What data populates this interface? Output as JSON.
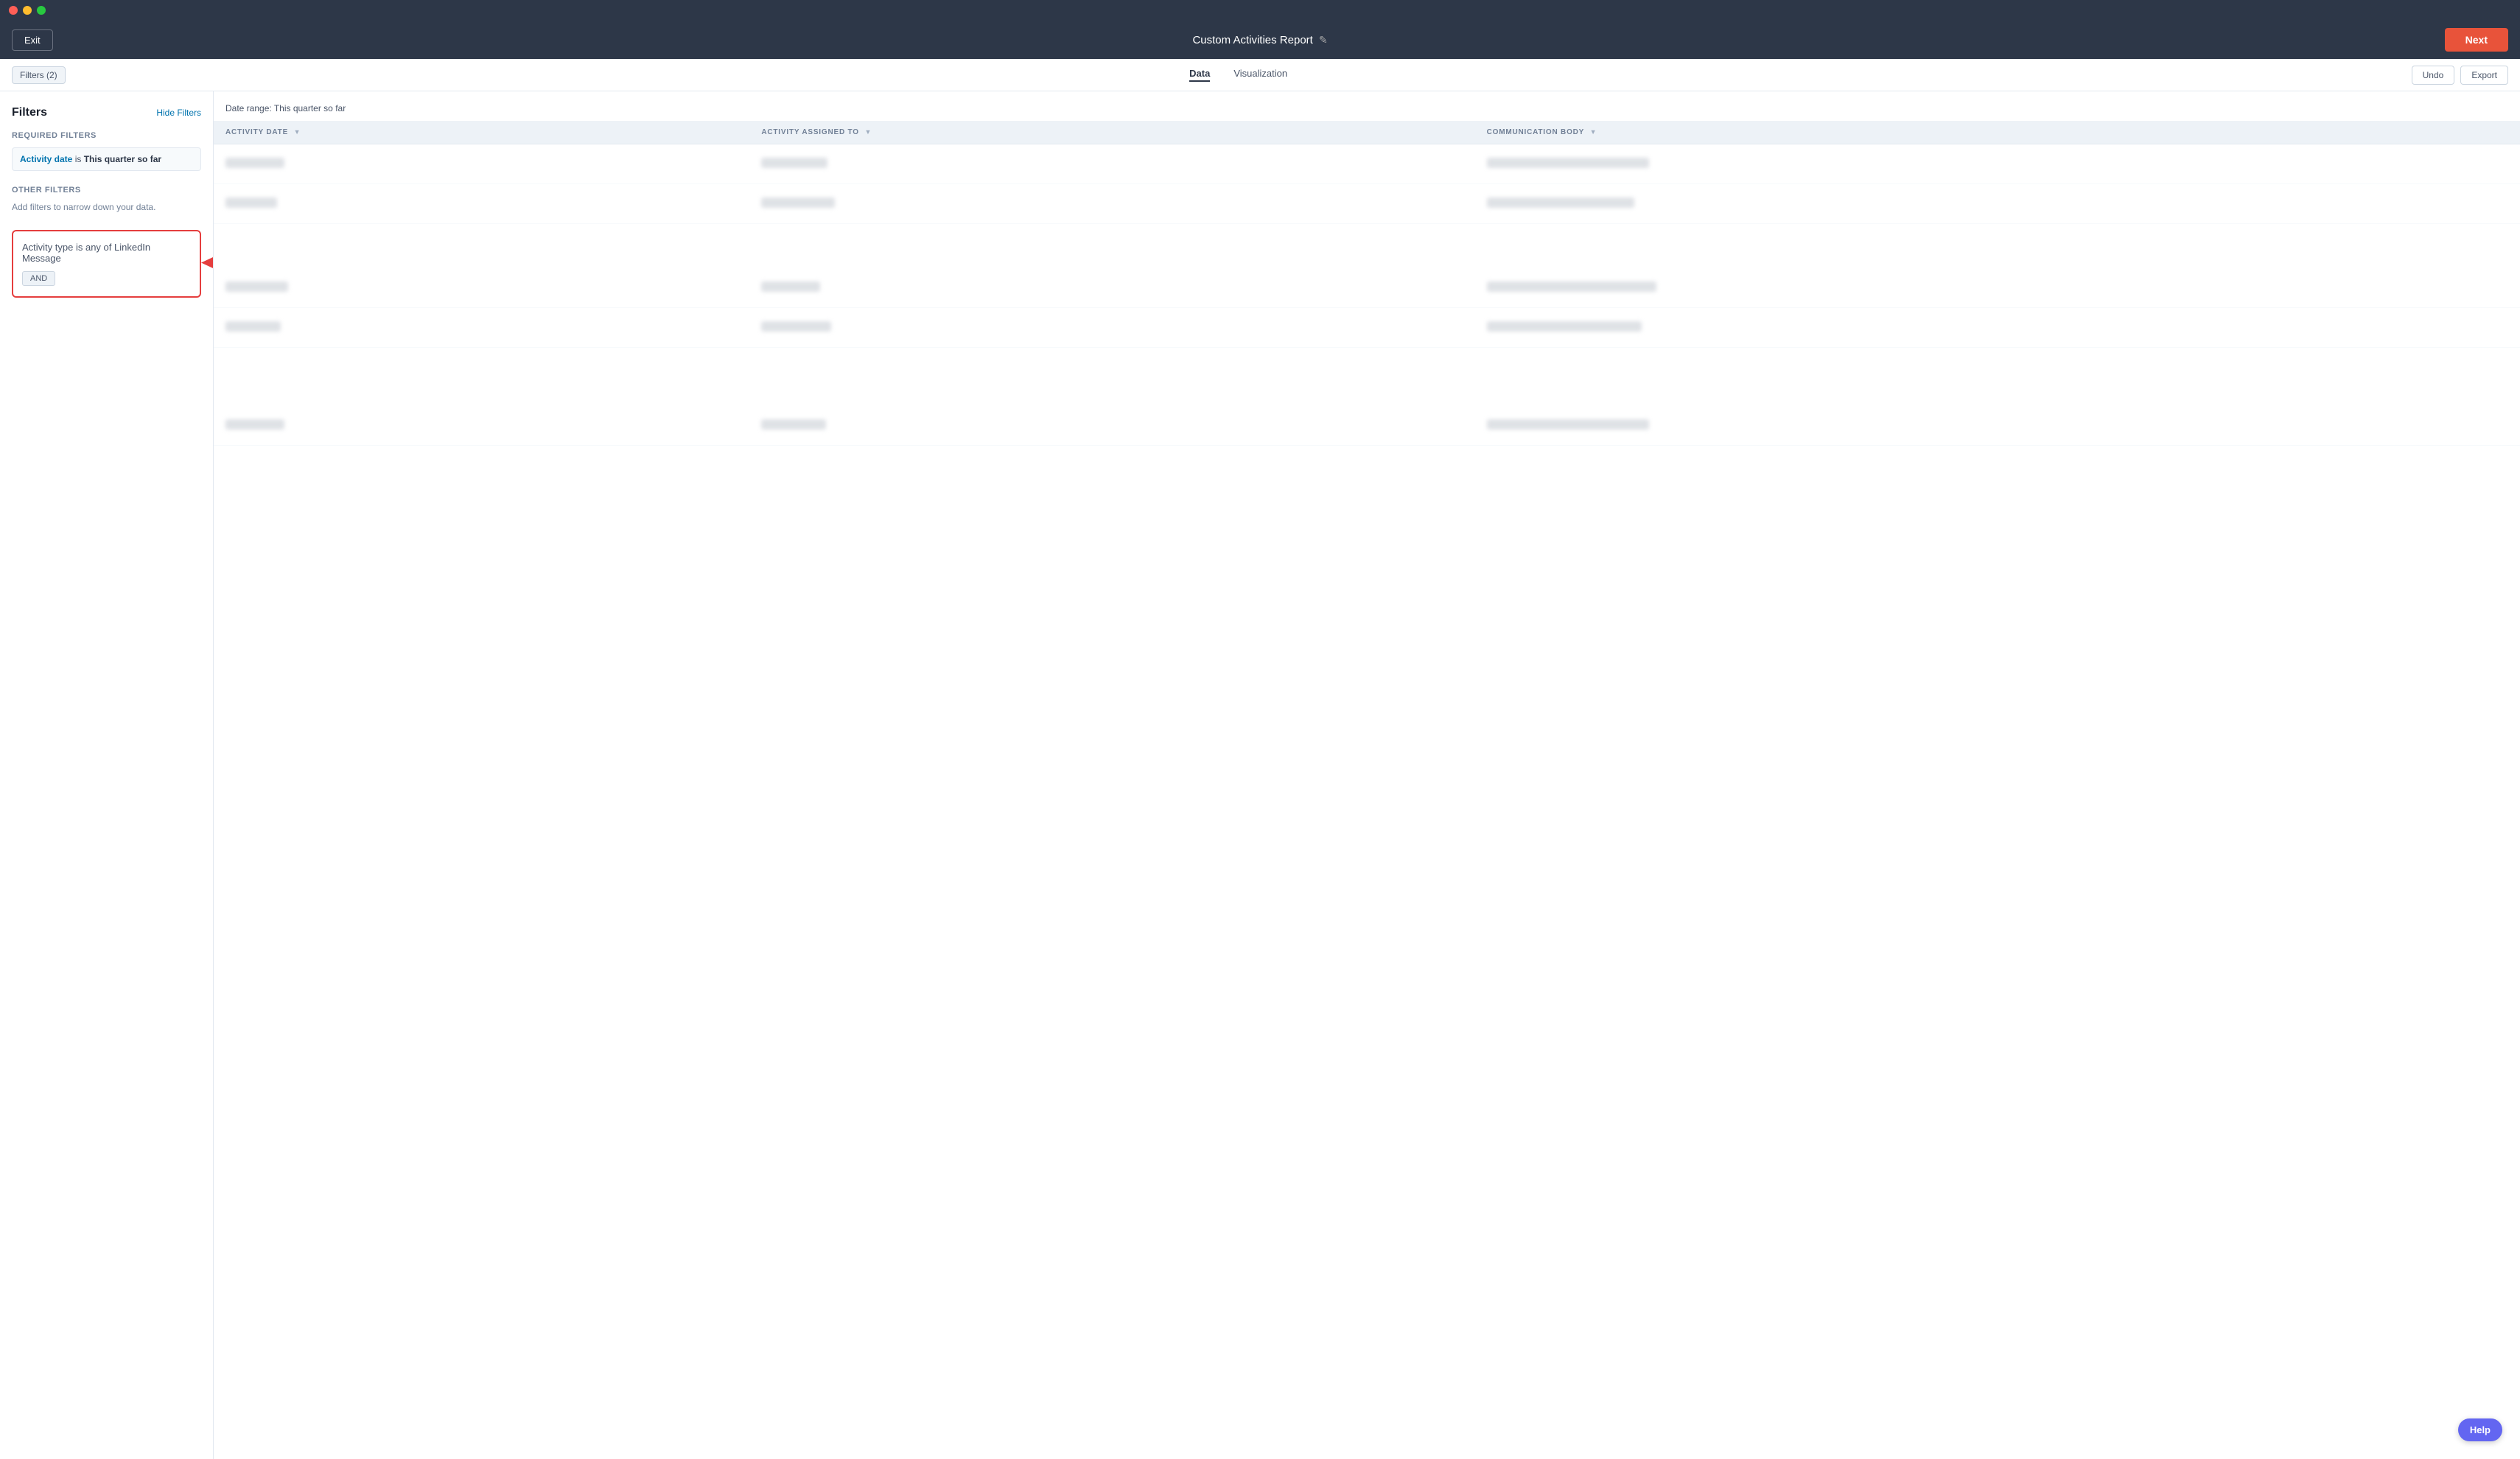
{
  "titlebar": {
    "dots": [
      "red",
      "yellow",
      "green"
    ]
  },
  "topnav": {
    "exit_label": "Exit",
    "title": "Custom Activities Report",
    "edit_icon": "✎",
    "next_label": "Next"
  },
  "tabbar": {
    "filters_badge": "Filters (2)",
    "tabs": [
      {
        "id": "data",
        "label": "Data",
        "active": true
      },
      {
        "id": "visualization",
        "label": "Visualization",
        "active": false
      }
    ],
    "undo_label": "Undo",
    "export_label": "Export"
  },
  "filters_panel": {
    "title": "Filters",
    "hide_filters_label": "Hide Filters",
    "required_section": "Required filters",
    "required_filter": {
      "link_text": "Activity date",
      "static_text": " is ",
      "bold_text": "This quarter so far"
    },
    "other_section": "Other filters",
    "other_desc": "Add filters to narrow down your data.",
    "highlighted_filter": {
      "link_text": "Activity type",
      "static_text": " is any of ",
      "bold_text": "LinkedIn Message"
    },
    "and_label": "AND"
  },
  "content": {
    "date_range_label": "Date range: This quarter so far",
    "columns": [
      {
        "id": "activity_date",
        "label": "ACTIVITY DATE",
        "sortable": true
      },
      {
        "id": "activity_assigned_to",
        "label": "ACTIVITY ASSIGNED TO",
        "sortable": true
      },
      {
        "id": "communication_body",
        "label": "COMMUNICATION BODY",
        "sortable": true
      }
    ],
    "blur_rows": [
      {
        "col1_w": 80,
        "col1_h": 14,
        "col2_w": 90,
        "col2_h": 14,
        "col3_w": 160,
        "col3_h": 14
      },
      {
        "col1_w": 70,
        "col1_h": 14,
        "col2_w": 100,
        "col2_h": 14,
        "col3_w": 140,
        "col3_h": 14
      },
      {
        "col1_w": 85,
        "col1_h": 14,
        "col2_w": 80,
        "col2_h": 14,
        "col3_w": 170,
        "col3_h": 14
      },
      {
        "col1_w": 75,
        "col1_h": 14,
        "col2_w": 95,
        "col2_h": 14,
        "col3_w": 150,
        "col3_h": 14
      },
      {
        "col1_w": 80,
        "col1_h": 14,
        "col2_w": 88,
        "col2_h": 14,
        "col3_w": 160,
        "col3_h": 14
      }
    ]
  },
  "help": {
    "label": "Help"
  }
}
